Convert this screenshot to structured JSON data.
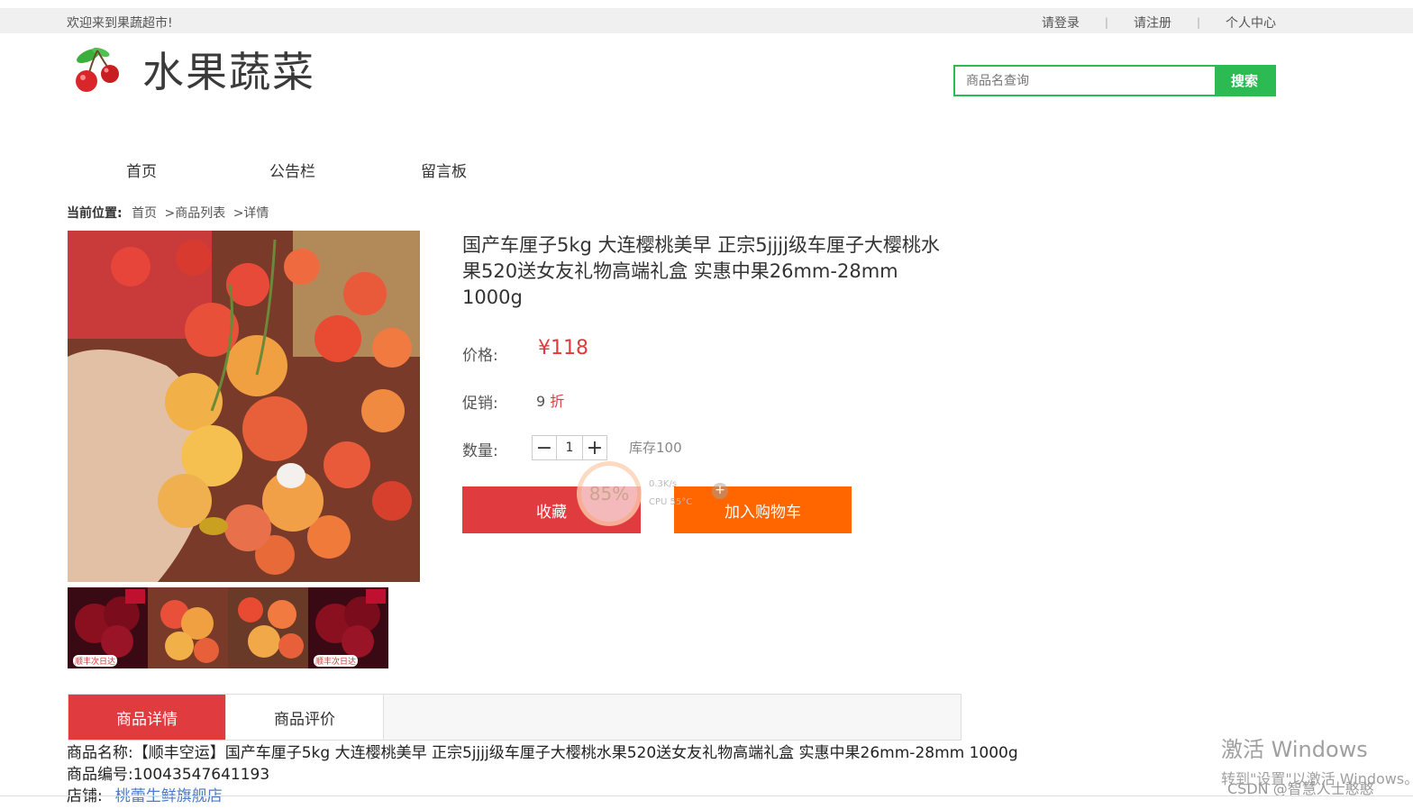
{
  "topbar": {
    "welcome": "欢迎来到果蔬超市!",
    "login": "请登录",
    "register": "请注册",
    "personal": "个人中心"
  },
  "logo": {
    "text": "水果蔬菜"
  },
  "search": {
    "placeholder": "商品名查询",
    "button": "搜索"
  },
  "nav": {
    "items": [
      "首页",
      "公告栏",
      "留言板"
    ]
  },
  "breadcrumb": {
    "label": "当前位置:",
    "home": "首页",
    "list": ">商品列表",
    "current": ">详情"
  },
  "product": {
    "title": "国产车厘子5kg 大连樱桃美早 正宗5jjjj级车厘子大樱桃水果520送女友礼物高端礼盒 实惠中果26mm-28mm 1000g",
    "price_label": "价格:",
    "price": "¥118",
    "promo_label": "促销:",
    "promo_value": "9",
    "promo_unit": "折",
    "qty_label": "数量:",
    "qty_minus": "−",
    "qty_value": "1",
    "qty_plus": "+",
    "stock": "库存100",
    "fav_button": "收藏",
    "cart_button": "加入购物车",
    "thumb_tags": [
      "顺丰次日达",
      "",
      "",
      "顺丰次日达"
    ],
    "thumb_badge": "5斤"
  },
  "cpu_widget": {
    "percent": "85%",
    "speed": "0.3K/s",
    "temp": "CPU 55°C"
  },
  "tabs": [
    "商品详情",
    "商品评价"
  ],
  "details": {
    "name_label": "商品名称:",
    "name_value": "【顺丰空运】国产车厘子5kg 大连樱桃美早 正宗5jjjj级车厘子大樱桃水果520送女友礼物高端礼盒 实惠中果26mm-28mm 1000g",
    "code_label": "商品编号:",
    "code_value": "10043547641193",
    "shop_label": "店铺:",
    "shop_value": "桃蕾生鲜旗舰店"
  },
  "watermark": {
    "line1": "激活 Windows",
    "line2": "转到\"设置\"以激活 Windows。",
    "csdn": "CSDN @智慧人士憨憨"
  },
  "colors": {
    "green": "#2bbb52",
    "red": "#e03b3e",
    "orange": "#ff6600",
    "price_red": "#e4393c"
  }
}
